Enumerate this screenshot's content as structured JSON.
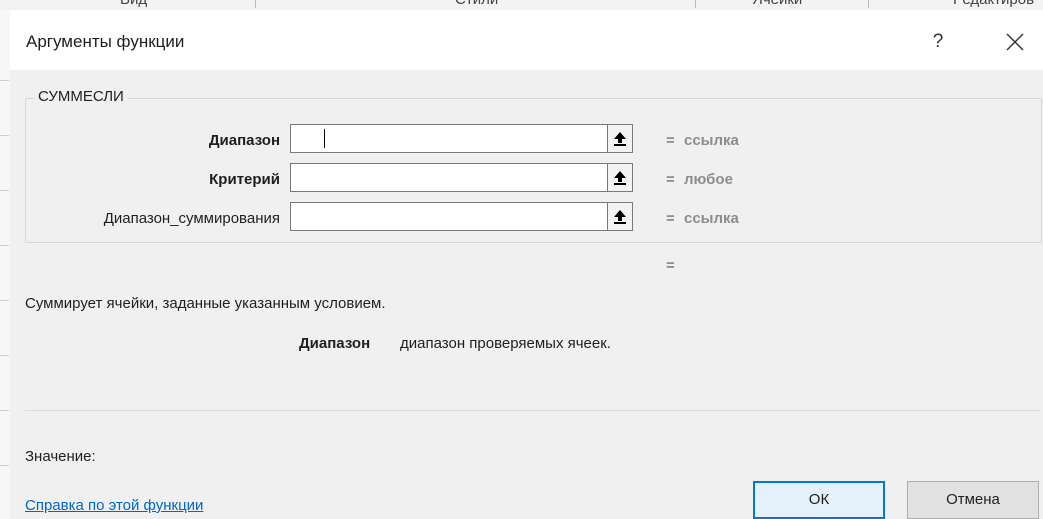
{
  "background": {
    "ribbon_labels": [
      "Вид",
      "Стили",
      "Ячейки",
      "Редактиров"
    ]
  },
  "dialog": {
    "title": "Аргументы функции",
    "help_button": "?",
    "function_name": "СУММЕСЛИ",
    "arguments": [
      {
        "label": "Диапазон",
        "bold": true,
        "value": "",
        "result": "ссылка"
      },
      {
        "label": "Критерий",
        "bold": true,
        "value": "",
        "result": "любое"
      },
      {
        "label": "Диапазон_суммирования",
        "bold": false,
        "value": "",
        "result": "ссылка"
      }
    ],
    "equals_sign": "=",
    "function_result": "",
    "description": "Суммирует ячейки, заданные указанным условием.",
    "arg_help": {
      "name": "Диапазон",
      "text": "диапазон проверяемых ячеек."
    },
    "value_label": "Значение:",
    "help_link": "Справка по этой функции",
    "ok_label": "ОК",
    "cancel_label": "Отмена"
  },
  "colors": {
    "accent": "#0078d7",
    "link": "#0066cc",
    "dialog_bg": "#f0f0f0",
    "result_gray": "#8d8d8d"
  }
}
